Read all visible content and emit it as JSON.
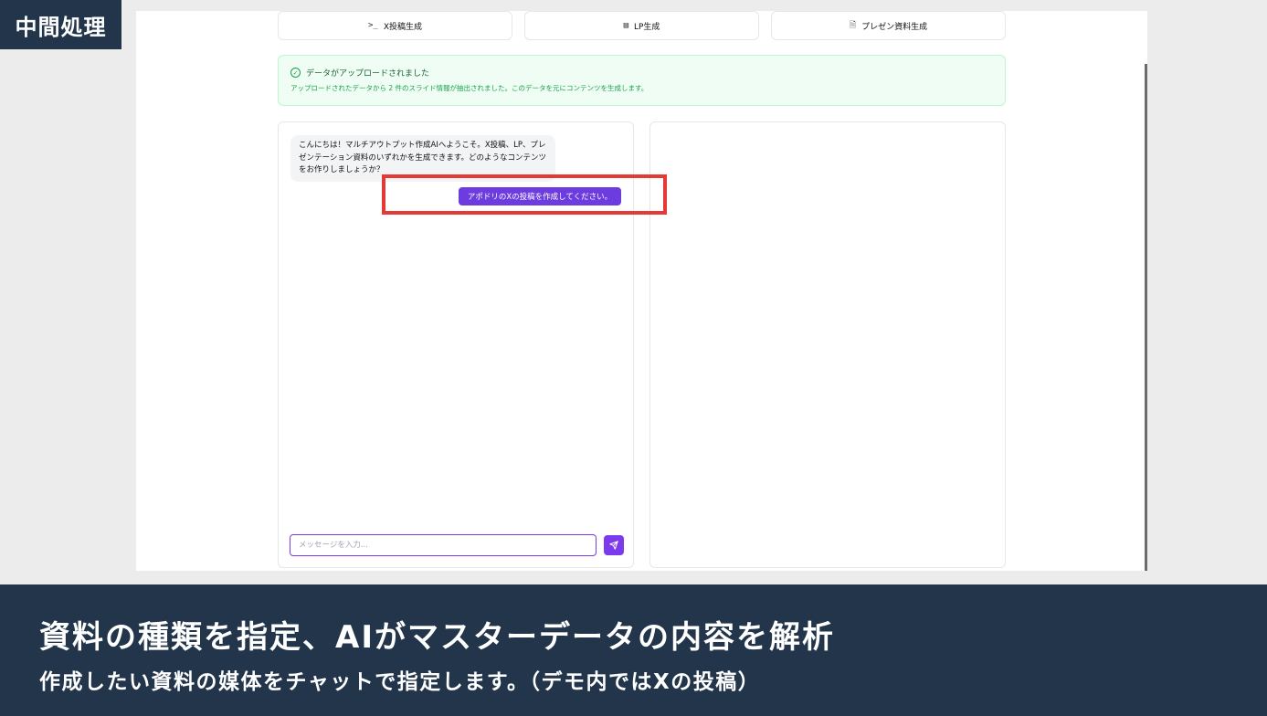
{
  "corner_label": "中間処理",
  "tabs": [
    {
      "icon": ">_",
      "label": "X投稿生成"
    },
    {
      "icon": "▤",
      "label": "LP生成"
    },
    {
      "icon": "🗎",
      "label": "プレゼン資料生成"
    }
  ],
  "alert": {
    "title": "データがアップロードされました",
    "description": "アップロードされたデータから 2 件のスライド情報が抽出されました。このデータを元にコンテンツを生成します。"
  },
  "chat": {
    "ai_message": "こんにちは！マルチアウトプット作成AIへようこそ。X投稿、LP、プレゼンテーション資料のいずれかを生成できます。どのようなコンテンツをお作りしましょうか？",
    "user_message": "アポドリのXの投稿を作成してください。",
    "input_placeholder": "メッセージを入力..."
  },
  "colors": {
    "accent": "#7c3aed",
    "highlight": "#e53935",
    "caption_bg": "#22354b"
  },
  "caption": {
    "title": "資料の種類を指定、AIがマスターデータの内容を解析",
    "subtitle": "作成したい資料の媒体をチャットで指定します。（デモ内ではXの投稿）"
  }
}
